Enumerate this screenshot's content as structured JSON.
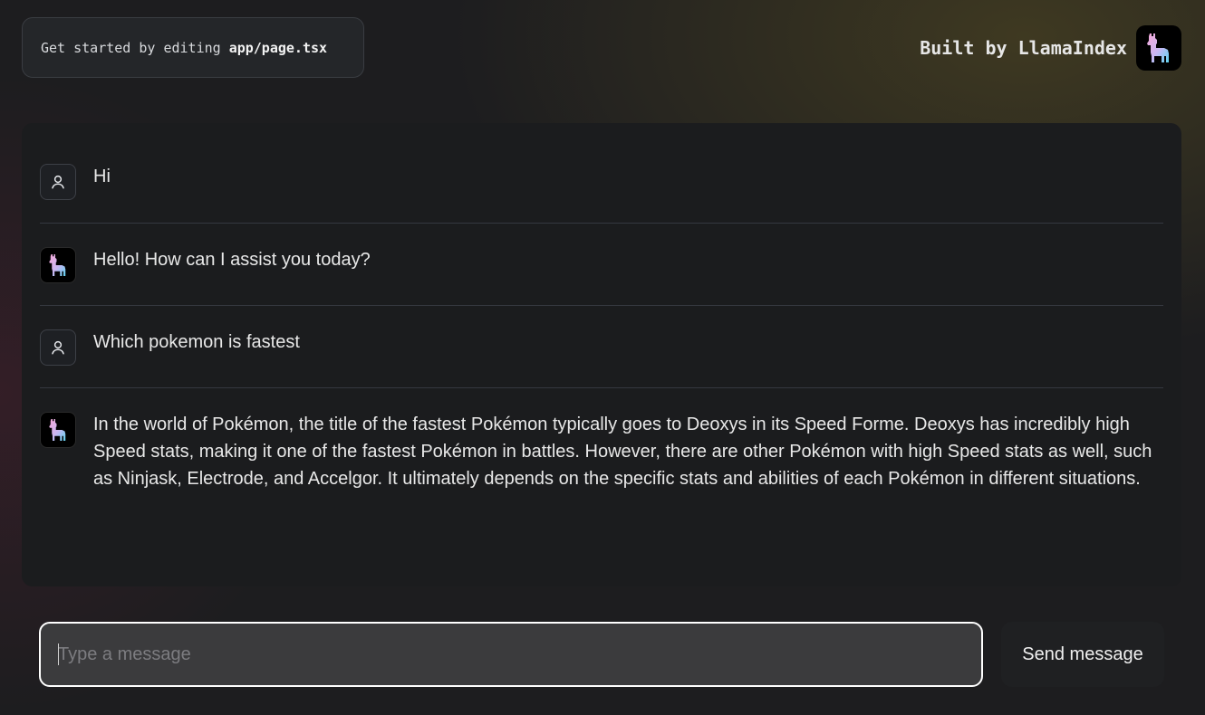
{
  "header": {
    "get_started_prefix": "Get started by editing",
    "get_started_code": "app/page.tsx",
    "built_by": "Built by LlamaIndex",
    "logo_icon": "llama-logo-icon"
  },
  "chat": {
    "messages": [
      {
        "role": "user",
        "avatar_icon": "user-icon",
        "text": "Hi"
      },
      {
        "role": "assistant",
        "avatar_icon": "llama-icon",
        "text": "Hello! How can I assist you today?"
      },
      {
        "role": "user",
        "avatar_icon": "user-icon",
        "text": "Which pokemon is fastest"
      },
      {
        "role": "assistant",
        "avatar_icon": "llama-icon",
        "text": "In the world of Pokémon, the title of the fastest Pokémon typically goes to Deoxys in its Speed Forme. Deoxys has incredibly high Speed stats, making it one of the fastest Pokémon in battles. However, there are other Pokémon with high Speed stats as well, such as Ninjask, Electrode, and Accelgor. It ultimately depends on the specific stats and abilities of each Pokémon in different situations."
      }
    ]
  },
  "composer": {
    "value": "",
    "placeholder": "Type a message",
    "send_label": "Send message"
  },
  "colors": {
    "background": "#1d1d1f",
    "panel": "#1b1c1e",
    "input_bg": "#3b3b3d",
    "llama_pink": "#f7a8d8",
    "llama_cyan": "#5fd3f0"
  }
}
